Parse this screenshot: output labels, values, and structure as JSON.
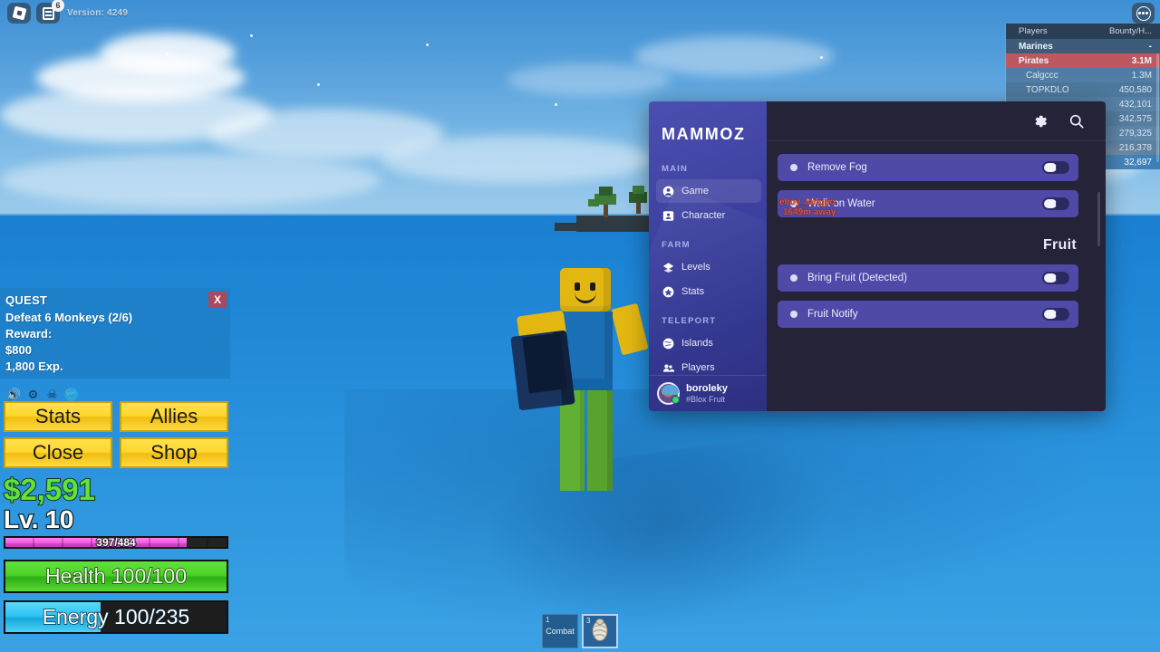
{
  "roblox_chrome": {
    "version_text": "Version: 4249",
    "notification_badge": "6",
    "logo_icon": "roblox-logo-icon",
    "menu_icon": "roblox-menu-icon",
    "more_icon": "more-options-icon"
  },
  "leaderboard": {
    "col_players": "Players",
    "col_bounty": "Bounty/H...",
    "teams": [
      {
        "name": "Marines",
        "value": "-"
      },
      {
        "name": "Pirates",
        "value": "3.1M"
      }
    ],
    "players": [
      {
        "name": "Calgccc",
        "value": "1.3M"
      },
      {
        "name": "TOPKDLO",
        "value": "450,580"
      },
      {
        "name": "",
        "value": "432,101"
      },
      {
        "name": "",
        "value": "342,575"
      },
      {
        "name": "",
        "value": "279,325"
      },
      {
        "name": "",
        "value": "216,378"
      },
      {
        "name": "",
        "value": "32,697"
      }
    ]
  },
  "quest": {
    "title": "QUEST",
    "close_label": "X",
    "objective": "Defeat 6 Monkeys (2/6)",
    "reward_label": "Reward:",
    "reward_money": "$800",
    "reward_exp": "1,800 Exp.",
    "icons": [
      "sound-icon",
      "gear-icon",
      "skull-crossbones-icon",
      "twitter-icon"
    ]
  },
  "hud": {
    "buttons": [
      "Stats",
      "Allies",
      "Close",
      "Shop"
    ],
    "money": "$2,591",
    "level": "Lv. 10",
    "exp_text": "397/484",
    "exp_percent": 82,
    "health_text": "Health 100/100",
    "health_percent": 100,
    "energy_text": "Energy 100/235",
    "energy_percent": 43
  },
  "hotbar": [
    {
      "num": "1",
      "label": "Combat",
      "selected": false
    },
    {
      "num": "3",
      "label": "",
      "icon": "shell-icon",
      "selected": true
    }
  ],
  "nametag": {
    "name": "eboy_langpo",
    "distance": "1649m away"
  },
  "gui": {
    "brand": "MAMMOZ",
    "settings_icon": "gear-icon",
    "search_icon": "search-icon",
    "nav": [
      {
        "section": "MAIN",
        "items": [
          {
            "label": "Game",
            "icon": "user-circle-icon",
            "active": true
          },
          {
            "label": "Character",
            "icon": "portrait-icon",
            "active": false
          }
        ]
      },
      {
        "section": "FARM",
        "items": [
          {
            "label": "Levels",
            "icon": "layers-icon",
            "active": false
          },
          {
            "label": "Stats",
            "icon": "star-circle-icon",
            "active": false
          }
        ]
      },
      {
        "section": "TELEPORT",
        "items": [
          {
            "label": "Islands",
            "icon": "globe-icon",
            "active": false
          },
          {
            "label": "Players",
            "icon": "people-icon",
            "active": false
          }
        ]
      }
    ],
    "user": {
      "name": "boroleky",
      "tag": "#Blox Fruit",
      "status": "online"
    },
    "toggles_top": [
      {
        "label": "Remove Fog",
        "on": true
      },
      {
        "label": "Walk on Water",
        "on": true
      }
    ],
    "section_fruit": "Fruit",
    "toggles_fruit": [
      {
        "label": "Bring Fruit (Detected)",
        "on": true
      },
      {
        "label": "Fruit Notify",
        "on": true
      }
    ]
  },
  "colors": {
    "gui_accent": "#4f4aa8",
    "gui_dark": "#242338",
    "sidebar": "#3e41a0",
    "quest_blue": "#1d7ec4",
    "hud_yellow": "#ffd62e",
    "money_green": "#62e23c",
    "pirates_red": "#c65254",
    "nametag_red": "#e8543a"
  }
}
